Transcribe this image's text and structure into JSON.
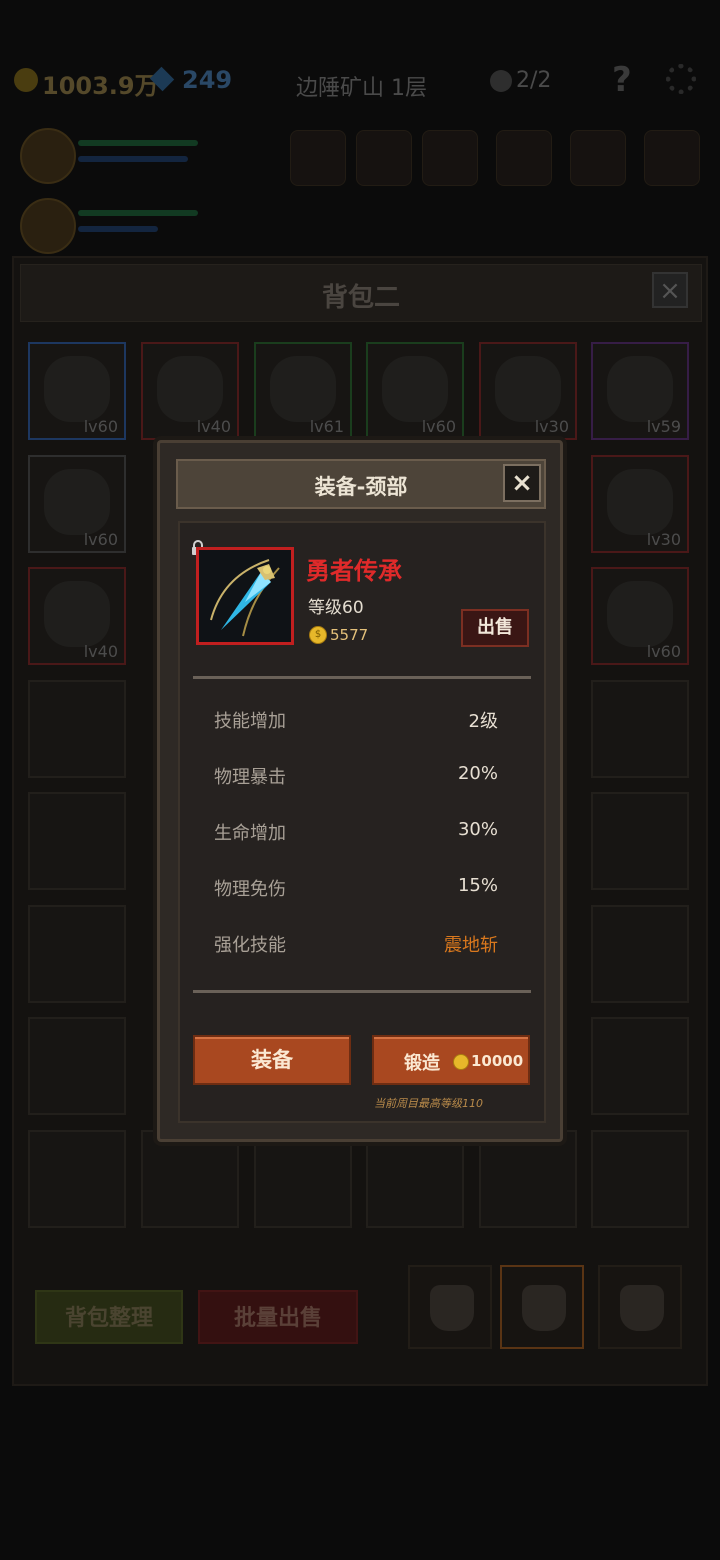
{
  "colors": {
    "accent_red": "#e02a2a",
    "button_orange": "#a94820",
    "skill_orange": "#d9781d",
    "coin_gold": "#e7b82a"
  },
  "topbar": {
    "gold": "1003.9万",
    "gems": "249",
    "location": "边陲矿山 1层",
    "kills": "2/2",
    "help_icon": "?"
  },
  "bag": {
    "title": "背包二",
    "close_glyph": "×",
    "items": [
      {
        "level": "lv60",
        "border": "blue"
      },
      {
        "level": "lv40",
        "border": "red"
      },
      {
        "level": "lv61",
        "border": "green"
      },
      {
        "level": "lv60",
        "border": "green"
      },
      {
        "level": "lv30",
        "border": "red"
      },
      {
        "level": "lv59",
        "border": "purple"
      },
      {
        "level": "lv60",
        "border": "gray"
      },
      {
        "level": "lv30",
        "border": "red"
      },
      {
        "level": "lv40",
        "border": "red"
      },
      {
        "level": "lv60",
        "border": "red"
      }
    ],
    "sort_button": "背包整理",
    "bulk_sell_button": "批量出售"
  },
  "modal": {
    "title": "装备-颈部",
    "close_glyph": "×",
    "item": {
      "name": "勇者传承",
      "level_text": "等级60",
      "coin_symbol": "$",
      "price": "5577",
      "locked": true
    },
    "sell_button": "出售",
    "stats": [
      {
        "label": "技能增加",
        "value": "2级"
      },
      {
        "label": "物理暴击",
        "value": "20%"
      },
      {
        "label": "生命增加",
        "value": "30%"
      },
      {
        "label": "物理免伤",
        "value": "15%"
      },
      {
        "label": "强化技能",
        "value": "震地斩"
      }
    ],
    "equip_button": "装备",
    "forge_button": "锻造",
    "forge_cost": "10000",
    "note": "当前周目最高等级110"
  }
}
